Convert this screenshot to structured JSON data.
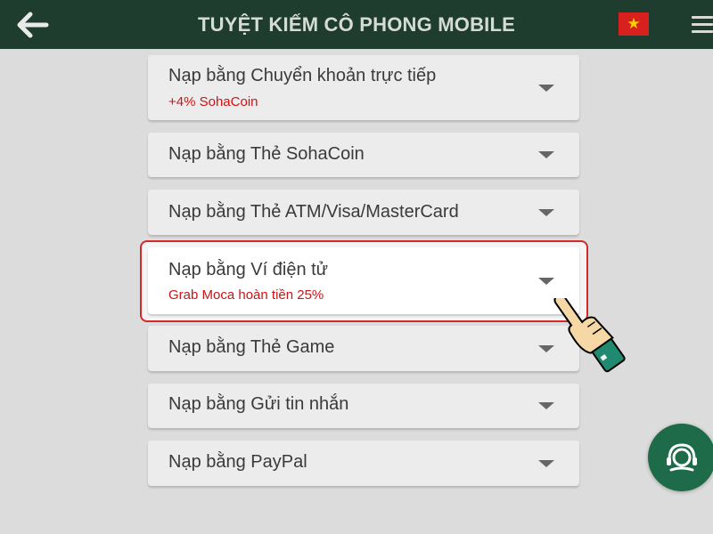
{
  "header": {
    "title": "TUYỆT KIẾM CÔ PHONG MOBILE",
    "back_icon": "arrow-left-icon",
    "flag_icon": "vietnam-flag-icon",
    "flag_star": "★",
    "menu_icon": "hamburger-menu-icon"
  },
  "methods": [
    {
      "label": "Nạp bằng Chuyển khoản trực tiếp",
      "promo": "+4% SohaCoin"
    },
    {
      "label": "Nạp bằng Thẻ SohaCoin"
    },
    {
      "label": "Nạp bằng Thẻ ATM/Visa/MasterCard"
    },
    {
      "label": "Nạp bằng Ví điện tử",
      "promo": "Grab Moca hoàn tiền 25%"
    },
    {
      "label": "Nạp bằng Thẻ Game"
    },
    {
      "label": "Nạp bằng Gửi tin nhắn"
    },
    {
      "label": "Nạp bằng PayPal"
    }
  ],
  "colors": {
    "header_bg": "#1e3d2f",
    "promo_text": "#cc1414",
    "highlight_border": "#d22a2a",
    "support_button": "#1d6b48"
  },
  "support": {
    "icon": "headset-support-icon"
  },
  "pointer": {
    "icon": "pointing-hand-icon"
  }
}
